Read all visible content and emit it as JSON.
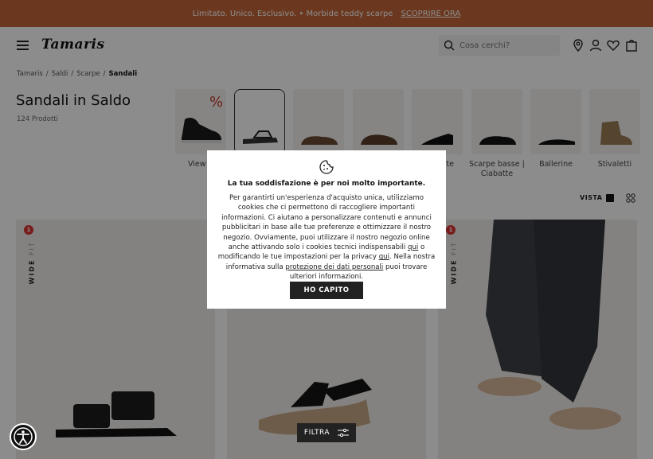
{
  "promo": {
    "text": "Limitato. Unico. Esclusivo. • Morbide teddy scarpe",
    "cta": "SCOPRIRE ORA"
  },
  "header": {
    "logo": "Tamaris",
    "search_placeholder": "Cosa cerchi?"
  },
  "breadcrumb": [
    "Tamaris",
    "/",
    "Saldi",
    "/",
    "Scarpe",
    "/",
    "Sandali"
  ],
  "page": {
    "title": "Sandali in Saldo",
    "count": "124 Prodotti"
  },
  "categories": [
    {
      "label": "View"
    },
    {
      "label": ""
    },
    {
      "label": ""
    },
    {
      "label": ""
    },
    {
      "label": "te"
    },
    {
      "label": "Scarpe basse | Ciabatte"
    },
    {
      "label": "Ballerine"
    },
    {
      "label": "Stivaletti"
    }
  ],
  "view": {
    "label": "VISTA"
  },
  "badges": {
    "count": "1",
    "wide": "WIDE",
    "fit": "FIT"
  },
  "cookie": {
    "title": "La tua soddisfazione è per noi molto importante.",
    "body_1": "Per garantirti un'esperienza d'acquisto unica, utilizziamo cookies che ci permettono di raccogliere importanti informazioni. Ci aiutano a personalizzare contenuti e annunci pubblicitari in base alle tue preferenze e ottimizzare il nostro negozio. Ovviamente, puoi utilizzare il nostro negozio online anche attivando solo i cookies tecnici indispensabili ",
    "link_qui_1": "qui",
    "body_2": " o modificando le tue impostazioni per la privacy ",
    "link_qui_2": "qui",
    "body_3": ". Nella nostra informativa sulla ",
    "link_privacy": "protezione dei dati personali",
    "body_4": "  puoi trovare ulteriori informazioni.",
    "button": "HO CAPITO"
  },
  "filter": {
    "label": "FILTRA"
  },
  "colors": {
    "promo": "#c4673a",
    "dark": "#222222",
    "badge": "#dd3333"
  }
}
